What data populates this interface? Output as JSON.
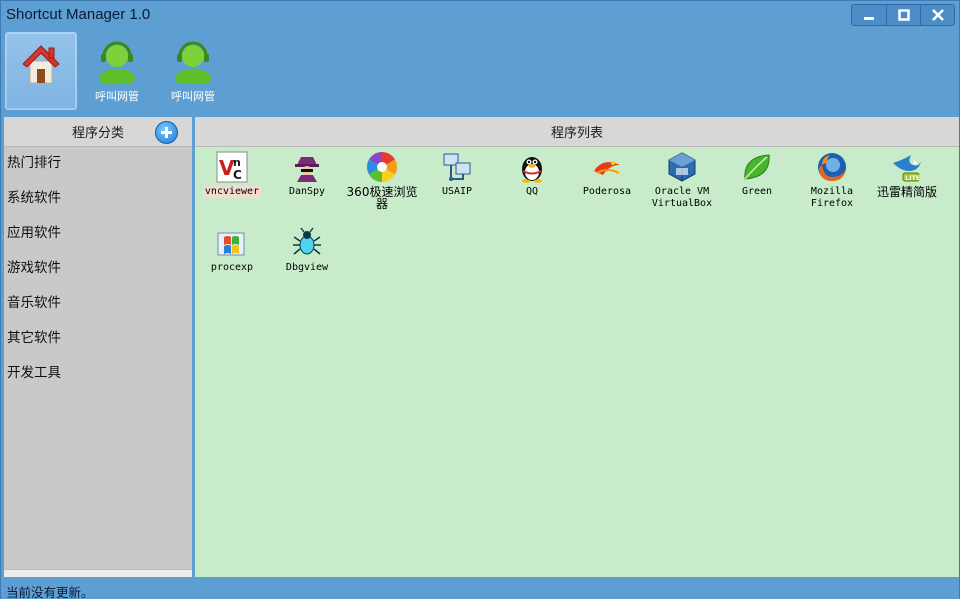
{
  "window": {
    "title": "Shortcut Manager 1.0",
    "controls": [
      "minimize",
      "maximize",
      "close"
    ]
  },
  "toolbar": {
    "buttons": [
      {
        "label": "",
        "icon": "home-icon",
        "active": true
      },
      {
        "label": "呼叫网管",
        "icon": "support-agent-icon",
        "active": false
      },
      {
        "label": "呼叫网管",
        "icon": "support-agent-icon",
        "active": false
      }
    ]
  },
  "left_panel": {
    "header": "程序分类",
    "add_icon": "add-circle-icon",
    "categories": [
      "热门排行",
      "系统软件",
      "应用软件",
      "游戏软件",
      "音乐软件",
      "其它软件",
      "开发工具"
    ]
  },
  "right_panel": {
    "header": "程序列表",
    "apps": [
      {
        "label": "vncviewer",
        "icon": "vnc-icon"
      },
      {
        "label": "DanSpy",
        "icon": "spy-icon"
      },
      {
        "label": "360极速浏览\n器",
        "icon": "360-browser-icon"
      },
      {
        "label": "USAIP",
        "icon": "network-computer-icon"
      },
      {
        "label": "QQ",
        "icon": "qq-penguin-icon"
      },
      {
        "label": "Poderosa",
        "icon": "poderosa-icon"
      },
      {
        "label": "Oracle VM\nVirtualBox",
        "icon": "virtualbox-icon"
      },
      {
        "label": "Green",
        "icon": "green-leaf-icon"
      },
      {
        "label": "Mozilla\nFirefox",
        "icon": "firefox-icon"
      },
      {
        "label": "迅雷精简版",
        "icon": "thunder-lite-icon"
      },
      {
        "label": "procexp",
        "icon": "procexp-icon"
      },
      {
        "label": "Dbgview",
        "icon": "dbgview-bug-icon"
      }
    ]
  },
  "status_bar": {
    "text": "当前没有更新。"
  },
  "colors": {
    "frame": "#5d9ed3",
    "sidebar": "#c9c9c9",
    "list_bg": "#c8ecca",
    "header_bg": "#d7d7d7"
  }
}
